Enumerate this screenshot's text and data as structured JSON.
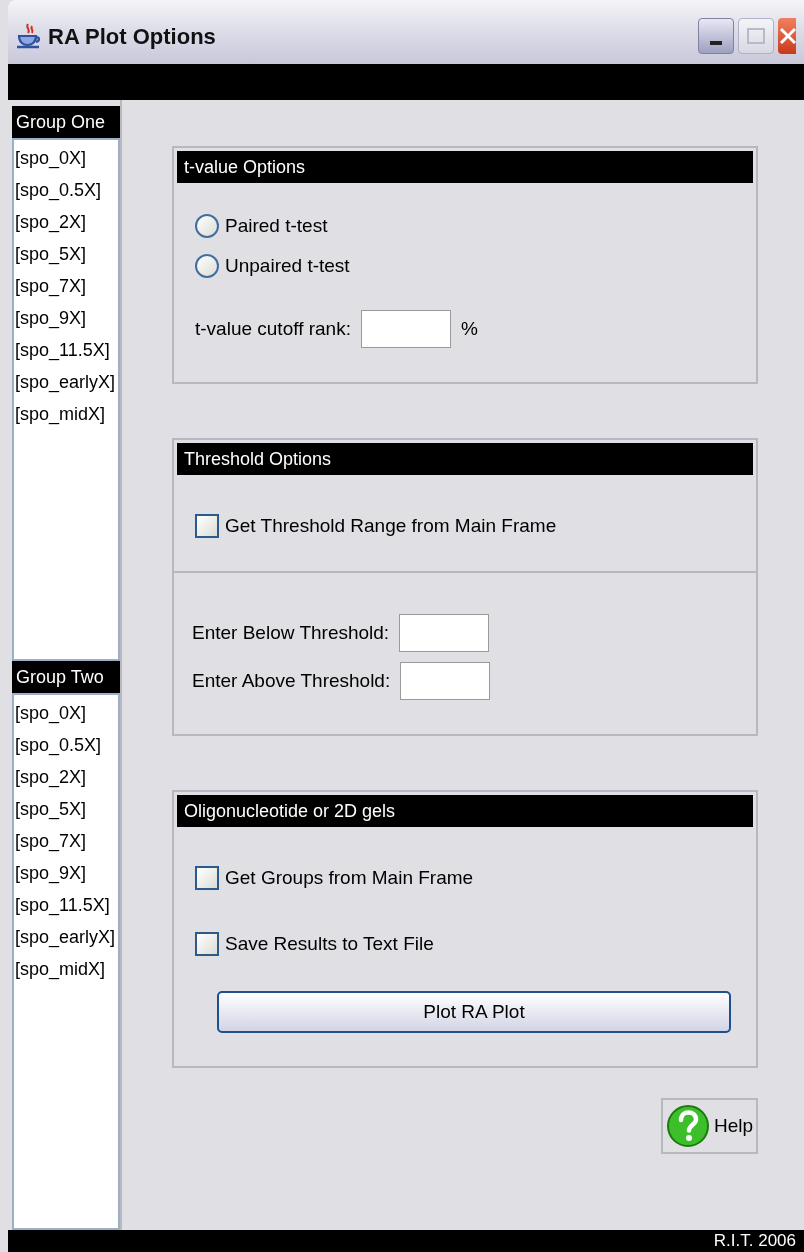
{
  "window": {
    "title": "RA Plot Options"
  },
  "groups": [
    {
      "title": "Group One",
      "items": [
        "[spo_0X]",
        "[spo_0.5X]",
        "[spo_2X]",
        "[spo_5X]",
        "[spo_7X]",
        "[spo_9X]",
        "[spo_11.5X]",
        "[spo_earlyX]",
        "[spo_midX]"
      ]
    },
    {
      "title": "Group Two",
      "items": [
        "[spo_0X]",
        "[spo_0.5X]",
        "[spo_2X]",
        "[spo_5X]",
        "[spo_7X]",
        "[spo_9X]",
        "[spo_11.5X]",
        "[spo_earlyX]",
        "[spo_midX]"
      ]
    }
  ],
  "panels": [
    {
      "title": "t-value Options",
      "sections": [
        [
          {
            "kind": "radio",
            "label": "Paired t-test",
            "selected": false
          },
          {
            "kind": "radio",
            "label": "Unpaired t-test",
            "selected": false
          },
          {
            "kind": "field",
            "label": "t-value cutoff rank:",
            "suffix": "%"
          }
        ]
      ]
    },
    {
      "title": "Threshold Options",
      "sections": [
        [
          {
            "kind": "checkbox",
            "label": "Get Threshold Range from Main Frame",
            "checked": false
          }
        ],
        [
          {
            "kind": "field",
            "label": "Enter Below Threshold:"
          },
          {
            "kind": "field",
            "label": "Enter Above Threshold:"
          }
        ]
      ]
    },
    {
      "title": "Oligonucleotide or 2D gels",
      "sections": [
        [
          {
            "kind": "checkbox",
            "label": "Get Groups from Main Frame",
            "checked": false
          },
          {
            "kind": "checkbox",
            "label": "Save Results to Text File",
            "checked": false
          },
          {
            "kind": "button",
            "label": "Plot RA Plot"
          }
        ]
      ]
    }
  ],
  "help_button": {
    "label": "Help"
  },
  "status_bar": {
    "text": "R.I.T. 2006"
  }
}
